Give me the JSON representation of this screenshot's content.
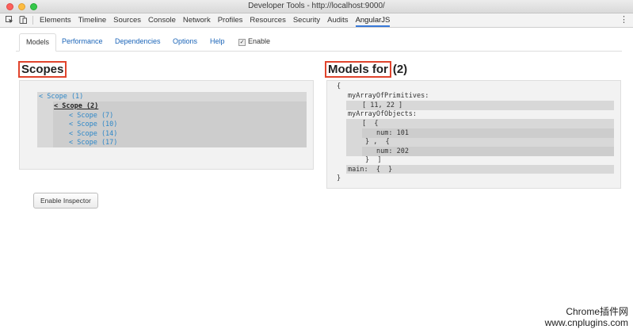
{
  "window": {
    "title": "Developer Tools - http://localhost:9000/"
  },
  "devtools": {
    "tabs": [
      "Elements",
      "Timeline",
      "Sources",
      "Console",
      "Network",
      "Profiles",
      "Resources",
      "Security",
      "Audits",
      "AngularJS"
    ],
    "active_tab": "AngularJS"
  },
  "angular": {
    "tabs": [
      {
        "label": "Models"
      },
      {
        "label": "Performance"
      },
      {
        "label": "Dependencies"
      },
      {
        "label": "Options"
      },
      {
        "label": "Help"
      },
      {
        "label": "Enable"
      }
    ],
    "active_tab": "Models"
  },
  "scopes": {
    "heading": "Scopes",
    "items": [
      {
        "label": "< Scope (1)"
      },
      {
        "label": "< Scope (2)"
      },
      {
        "label": "< Scope (7)"
      },
      {
        "label": "< Scope (10)"
      },
      {
        "label": "< Scope (14)"
      },
      {
        "label": "< Scope (17)"
      }
    ]
  },
  "models": {
    "heading": "Models for",
    "scope_ref": "(2)",
    "lines": [
      "{",
      "myArrayOfPrimitives:",
      "[ 11, 22 ]",
      "myArrayOfObjects:",
      "[  {",
      "num: 101",
      "} ,  {",
      "num: 202",
      "}  ]",
      "main:  {  }",
      "}"
    ]
  },
  "inspector_button": "Enable Inspector",
  "watermark": {
    "line1": "Chrome插件网",
    "line2": "www.cnplugins.com"
  },
  "colors": {
    "highlight": "#e0442d",
    "link": "#2f88c8",
    "tab_underline": "#3879d9"
  }
}
